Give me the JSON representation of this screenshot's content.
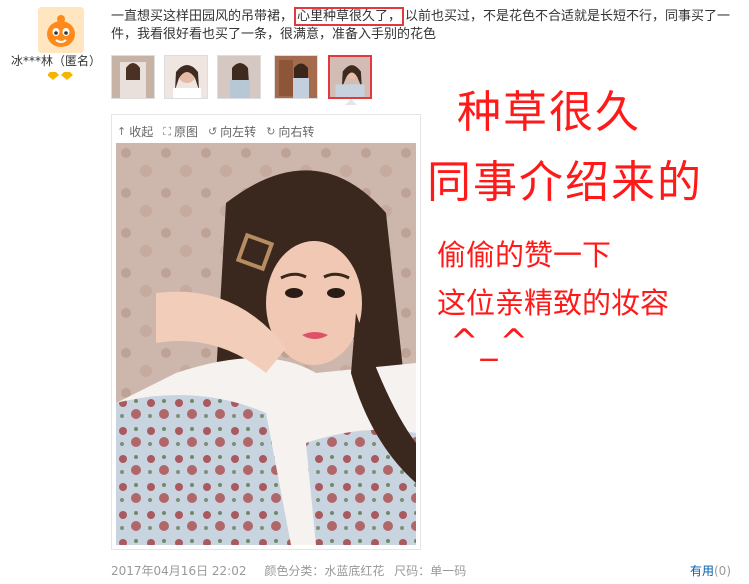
{
  "reviewer": {
    "username": "冰***林（匿名）",
    "avatar_icon": "jd-joy-avatar",
    "level_icon": "gold-member-icon"
  },
  "comment": {
    "text_before": "一直想买这样田园风的吊带裙，",
    "text_highlight": "心里种草很久了，",
    "text_after": "以前也买过，不是花色不合适就是长短不行，同事买了一件，我看很好看也买了一条，很满意，准备入手别的花色"
  },
  "viewer": {
    "collapse_label": "收起",
    "original_label": "原图",
    "rotate_left_label": "向左转",
    "rotate_right_label": "向右转"
  },
  "annotations": {
    "line1": "种草很久",
    "line2": "同事介绍来的",
    "line3": "偷偷的赞一下",
    "line4": "这位亲精致的妆容",
    "line5": "^_^"
  },
  "footer": {
    "date": "2017年04月16日 22:02",
    "color_label": "颜色分类：",
    "color_value": "水蓝底红花",
    "size_label": "尺码：",
    "size_value": "单一码",
    "useful_label": "有用",
    "useful_count": "(0)"
  },
  "colors": {
    "highlight_border": "#e4393c",
    "annotation_red": "#ff1a1a",
    "link_blue": "#005ea7"
  }
}
